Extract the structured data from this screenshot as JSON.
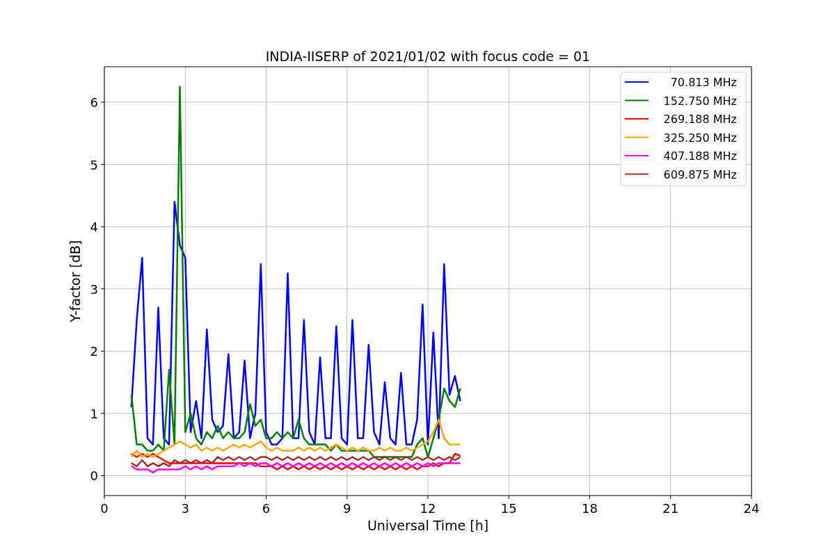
{
  "chart": {
    "chart_data": {
      "type": "line",
      "title": "INDIA-IISERP of 2021/01/02 with focus code = 01",
      "xlabel": "Universal Time [h]",
      "ylabel": "Y-factor [dB]",
      "x": [
        1,
        1.2,
        1.4,
        1.6,
        1.8,
        2,
        2.2,
        2.4,
        2.6,
        2.8,
        3,
        3.2,
        3.4,
        3.6,
        3.8,
        4,
        4.2,
        4.4,
        4.6,
        4.8,
        5,
        5.2,
        5.4,
        5.6,
        5.8,
        6,
        6.2,
        6.4,
        6.6,
        6.8,
        7,
        7.2,
        7.4,
        7.6,
        7.8,
        8,
        8.2,
        8.4,
        8.6,
        8.8,
        9,
        9.2,
        9.4,
        9.6,
        9.8,
        10,
        10.2,
        10.4,
        10.6,
        10.8,
        11,
        11.2,
        11.4,
        11.6,
        11.8,
        12,
        12.2,
        12.4,
        12.6,
        12.8,
        13,
        13.2
      ],
      "series": [
        {
          "name": "70.813 MHz",
          "color": "#0000ff",
          "values": [
            1.1,
            2.5,
            3.5,
            0.6,
            0.5,
            2.7,
            0.6,
            0.5,
            4.4,
            3.7,
            3.5,
            0.7,
            1.2,
            0.6,
            2.35,
            0.9,
            0.7,
            0.8,
            1.95,
            0.6,
            0.7,
            1.85,
            0.6,
            1.0,
            3.4,
            0.7,
            0.5,
            0.5,
            0.6,
            3.25,
            0.6,
            0.6,
            2.5,
            0.7,
            0.5,
            1.9,
            0.6,
            0.6,
            2.4,
            0.6,
            0.5,
            2.5,
            0.6,
            0.6,
            2.1,
            0.7,
            0.5,
            1.5,
            0.6,
            0.5,
            1.65,
            0.5,
            0.5,
            0.9,
            2.75,
            0.5,
            2.3,
            0.6,
            3.4,
            1.3,
            1.6,
            1.2
          ]
        },
        {
          "name": "152.750 MHz",
          "color": "#008000",
          "values": [
            1.3,
            0.5,
            0.5,
            0.4,
            0.4,
            0.5,
            0.4,
            1.7,
            0.5,
            6.25,
            0.7,
            1.0,
            0.6,
            0.5,
            0.7,
            0.6,
            0.8,
            0.6,
            0.7,
            0.6,
            0.6,
            0.7,
            1.15,
            0.8,
            0.9,
            0.6,
            0.6,
            0.7,
            0.6,
            0.7,
            0.6,
            0.9,
            0.6,
            0.5,
            0.5,
            0.5,
            0.5,
            0.4,
            0.5,
            0.4,
            0.4,
            0.4,
            0.4,
            0.4,
            0.4,
            0.3,
            0.3,
            0.3,
            0.3,
            0.3,
            0.3,
            0.3,
            0.3,
            0.5,
            0.6,
            0.3,
            0.6,
            0.9,
            1.4,
            1.2,
            1.1,
            1.4
          ]
        },
        {
          "name": "269.188 MHz",
          "color": "#ff0000",
          "values": [
            0.35,
            0.3,
            0.35,
            0.3,
            0.35,
            0.3,
            0.25,
            0.2,
            0.2,
            0.2,
            0.2,
            0.2,
            0.2,
            0.2,
            0.2,
            0.2,
            0.2,
            0.2,
            0.2,
            0.2,
            0.2,
            0.2,
            0.2,
            0.2,
            0.15,
            0.15,
            0.15,
            0.1,
            0.15,
            0.1,
            0.15,
            0.1,
            0.15,
            0.1,
            0.15,
            0.1,
            0.15,
            0.1,
            0.15,
            0.1,
            0.15,
            0.1,
            0.15,
            0.1,
            0.15,
            0.1,
            0.15,
            0.1,
            0.15,
            0.1,
            0.15,
            0.1,
            0.15,
            0.1,
            0.15,
            0.15,
            0.2,
            0.15,
            0.2,
            0.2,
            0.35,
            0.32
          ]
        },
        {
          "name": "325.250 MHz",
          "color": "#ffa500",
          "values": [
            0.3,
            0.4,
            0.3,
            0.35,
            0.3,
            0.35,
            0.4,
            0.45,
            0.5,
            0.55,
            0.5,
            0.45,
            0.5,
            0.4,
            0.45,
            0.4,
            0.45,
            0.4,
            0.45,
            0.5,
            0.45,
            0.5,
            0.45,
            0.5,
            0.55,
            0.45,
            0.4,
            0.45,
            0.4,
            0.4,
            0.4,
            0.45,
            0.4,
            0.45,
            0.4,
            0.45,
            0.4,
            0.45,
            0.5,
            0.45,
            0.4,
            0.45,
            0.4,
            0.45,
            0.4,
            0.4,
            0.45,
            0.4,
            0.45,
            0.4,
            0.4,
            0.45,
            0.4,
            0.45,
            0.5,
            0.55,
            0.7,
            0.9,
            0.6,
            0.5,
            0.5,
            0.5
          ]
        },
        {
          "name": "407.188 MHz",
          "color": "#ff00ff",
          "values": [
            0.15,
            0.1,
            0.1,
            0.1,
            0.05,
            0.1,
            0.1,
            0.1,
            0.1,
            0.1,
            0.15,
            0.1,
            0.15,
            0.1,
            0.15,
            0.1,
            0.15,
            0.15,
            0.15,
            0.15,
            0.2,
            0.15,
            0.2,
            0.15,
            0.2,
            0.2,
            0.15,
            0.2,
            0.15,
            0.2,
            0.15,
            0.2,
            0.15,
            0.2,
            0.15,
            0.2,
            0.15,
            0.2,
            0.15,
            0.2,
            0.15,
            0.2,
            0.15,
            0.2,
            0.15,
            0.2,
            0.15,
            0.2,
            0.15,
            0.2,
            0.15,
            0.2,
            0.15,
            0.2,
            0.15,
            0.2,
            0.15,
            0.2,
            0.2,
            0.2,
            0.2,
            0.2
          ]
        },
        {
          "name": "609.875 MHz",
          "color": "#a52a2a",
          "values": [
            0.2,
            0.15,
            0.25,
            0.15,
            0.2,
            0.15,
            0.2,
            0.15,
            0.25,
            0.2,
            0.25,
            0.2,
            0.25,
            0.2,
            0.25,
            0.2,
            0.3,
            0.25,
            0.3,
            0.25,
            0.3,
            0.25,
            0.3,
            0.25,
            0.3,
            0.3,
            0.25,
            0.3,
            0.25,
            0.3,
            0.25,
            0.3,
            0.25,
            0.3,
            0.25,
            0.3,
            0.25,
            0.3,
            0.25,
            0.3,
            0.25,
            0.3,
            0.25,
            0.3,
            0.25,
            0.3,
            0.25,
            0.3,
            0.25,
            0.3,
            0.25,
            0.3,
            0.25,
            0.3,
            0.25,
            0.3,
            0.25,
            0.3,
            0.25,
            0.3,
            0.25,
            0.3
          ]
        }
      ],
      "xlim": [
        0,
        24
      ],
      "ylim": [
        -0.32,
        6.57
      ],
      "xticks": [
        0,
        3,
        6,
        9,
        12,
        15,
        18,
        21,
        24
      ],
      "yticks": [
        0,
        1,
        2,
        3,
        4,
        5,
        6
      ],
      "grid": true,
      "legend": true
    }
  }
}
